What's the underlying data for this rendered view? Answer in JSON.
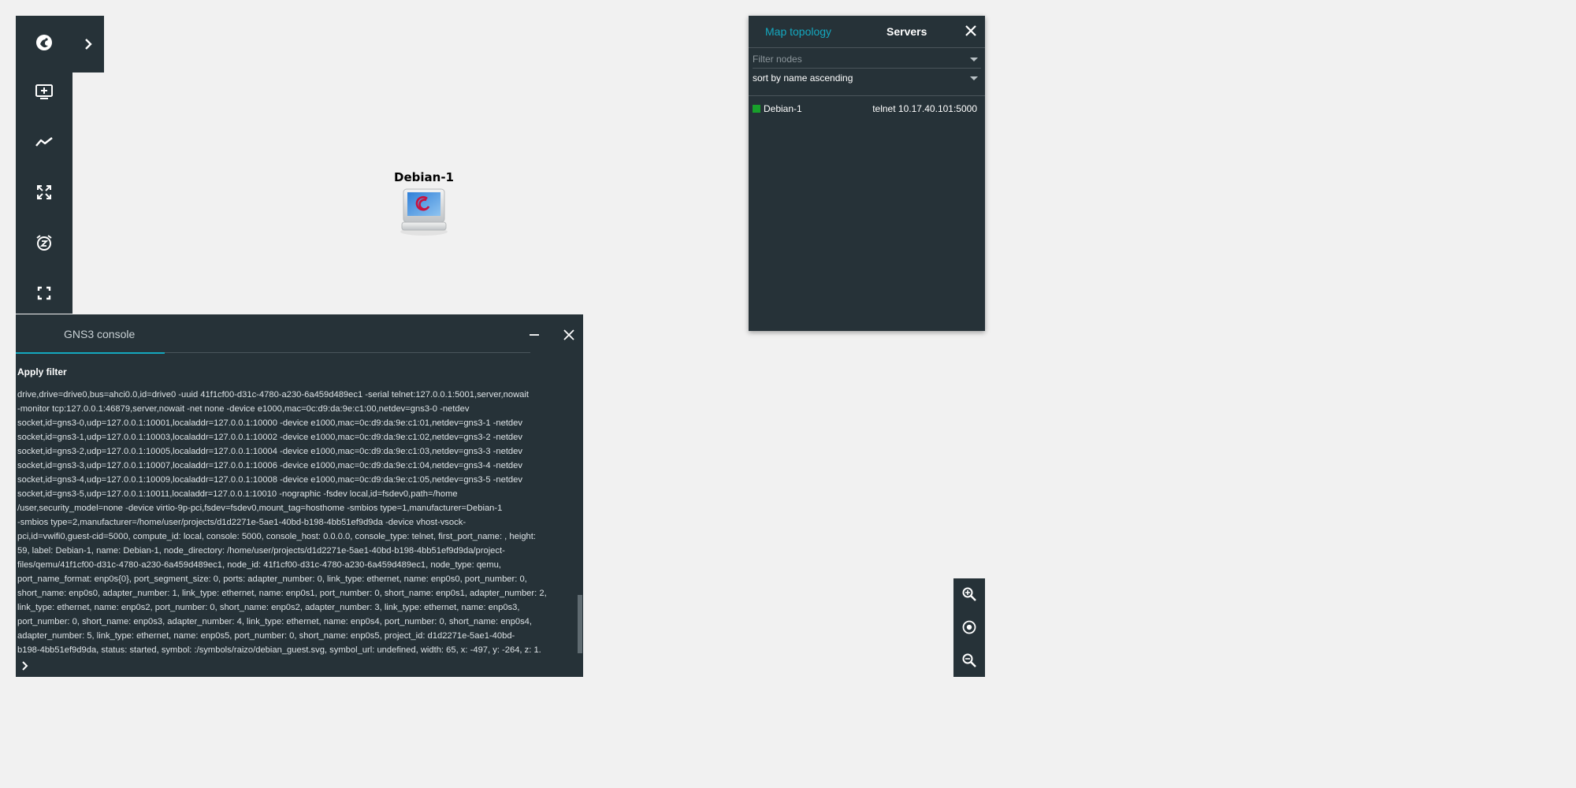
{
  "toolbar": {
    "items": [
      "gns3-logo-icon",
      "add-node-icon",
      "draw-link-icon",
      "fit-to-screen-icon",
      "snooze-icon",
      "fullscreen-icon"
    ],
    "expand_icon": "chevron-right-icon"
  },
  "topology": {
    "tab_map": "Map topology",
    "tab_servers": "Servers",
    "filter_placeholder": "Filter nodes",
    "sort_label": "sort by name ascending",
    "nodes": [
      {
        "name": "Debian-1",
        "console": "telnet 10.17.40.101:5000",
        "status_color": "#18a02b"
      }
    ]
  },
  "canvas": {
    "node_label": "Debian-1"
  },
  "console": {
    "title": "GNS3 console",
    "apply_filter": "Apply filter",
    "lines": [
      "drive,drive=drive0,bus=ahci0.0,id=drive0 -uuid 41f1cf00-d31c-4780-a230-6a459d489ec1 -serial telnet:127.0.0.1:5001,server,nowait",
      "-monitor tcp:127.0.0.1:46879,server,nowait -net none -device e1000,mac=0c:d9:da:9e:c1:00,netdev=gns3-0 -netdev",
      "socket,id=gns3-0,udp=127.0.0.1:10001,localaddr=127.0.0.1:10000 -device e1000,mac=0c:d9:da:9e:c1:01,netdev=gns3-1 -netdev",
      "socket,id=gns3-1,udp=127.0.0.1:10003,localaddr=127.0.0.1:10002 -device e1000,mac=0c:d9:da:9e:c1:02,netdev=gns3-2 -netdev",
      "socket,id=gns3-2,udp=127.0.0.1:10005,localaddr=127.0.0.1:10004 -device e1000,mac=0c:d9:da:9e:c1:03,netdev=gns3-3 -netdev",
      "socket,id=gns3-3,udp=127.0.0.1:10007,localaddr=127.0.0.1:10006 -device e1000,mac=0c:d9:da:9e:c1:04,netdev=gns3-4 -netdev",
      "socket,id=gns3-4,udp=127.0.0.1:10009,localaddr=127.0.0.1:10008 -device e1000,mac=0c:d9:da:9e:c1:05,netdev=gns3-5 -netdev",
      "socket,id=gns3-5,udp=127.0.0.1:10011,localaddr=127.0.0.1:10010 -nographic -fsdev local,id=fsdev0,path=/home",
      "/user,security_model=none -device virtio-9p-pci,fsdev=fsdev0,mount_tag=hosthome -smbios type=1,manufacturer=Debian-1",
      "-smbios type=2,manufacturer=/home/user/projects/d1d2271e-5ae1-40bd-b198-4bb51ef9d9da -device vhost-vsock-",
      "pci,id=vwifi0,guest-cid=5000, compute_id: local, console: 5000, console_host: 0.0.0.0, console_type: telnet, first_port_name: , height:",
      "59, label: Debian-1, name: Debian-1, node_directory: /home/user/projects/d1d2271e-5ae1-40bd-b198-4bb51ef9d9da/project-",
      "files/qemu/41f1cf00-d31c-4780-a230-6a459d489ec1, node_id: 41f1cf00-d31c-4780-a230-6a459d489ec1, node_type: qemu,",
      "port_name_format: enp0s{0}, port_segment_size: 0, ports: adapter_number: 0, link_type: ethernet, name: enp0s0, port_number: 0,",
      "short_name: enp0s0, adapter_number: 1, link_type: ethernet, name: enp0s1, port_number: 0, short_name: enp0s1, adapter_number: 2,",
      "link_type: ethernet, name: enp0s2, port_number: 0, short_name: enp0s2, adapter_number: 3, link_type: ethernet, name: enp0s3,",
      "port_number: 0, short_name: enp0s3, adapter_number: 4, link_type: ethernet, name: enp0s4, port_number: 0, short_name: enp0s4,",
      "adapter_number: 5, link_type: ethernet, name: enp0s5, port_number: 0, short_name: enp0s5, project_id: d1d2271e-5ae1-40bd-",
      "b198-4bb51ef9d9da, status: started, symbol: :/symbols/raizo/debian_guest.svg, symbol_url: undefined, width: 65, x: -497, y: -264, z: 1."
    ]
  },
  "zoom": {
    "items": [
      "zoom-in-icon",
      "reset-zoom-icon",
      "zoom-out-icon"
    ]
  },
  "colors": {
    "panel_bg": "#263238",
    "accent": "#14a8bf",
    "canvas_bg": "#f1f1f1",
    "status_started": "#18a02b"
  }
}
